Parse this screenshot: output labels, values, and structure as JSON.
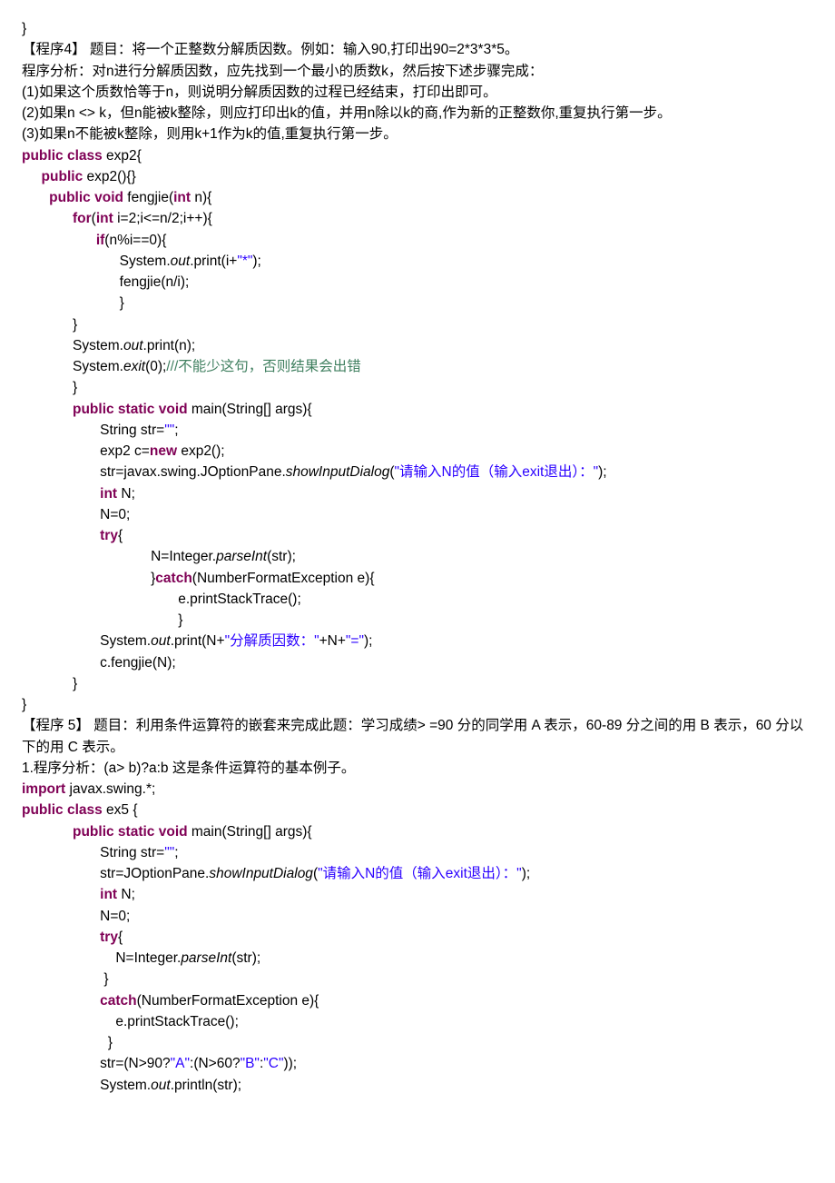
{
  "lines": [
    {
      "cls": "code",
      "segs": [
        {
          "t": "}"
        }
      ]
    },
    {
      "cls": "txt",
      "segs": [
        {
          "t": "【程序4】   题目：将一个正整数分解质因数。例如：输入90,打印出90=2*3*3*5。"
        }
      ]
    },
    {
      "cls": "txt",
      "segs": [
        {
          "t": "程序分析：对n进行分解质因数，应先找到一个最小的质数k，然后按下述步骤完成："
        }
      ]
    },
    {
      "cls": "txt",
      "segs": [
        {
          "t": "(1)如果这个质数恰等于n，则说明分解质因数的过程已经结束，打印出即可。"
        }
      ]
    },
    {
      "cls": "txt",
      "segs": [
        {
          "t": "(2)如果n <> k，但n能被k整除，则应打印出k的值，并用n除以k的商,作为新的正整数你,重复执行第一步。"
        }
      ]
    },
    {
      "cls": "txt",
      "segs": [
        {
          "t": "(3)如果n不能被k整除，则用k+1作为k的值,重复执行第一步。"
        }
      ]
    },
    {
      "cls": "code",
      "segs": [
        {
          "t": "public class",
          "c": "kw"
        },
        {
          "t": " exp2{"
        }
      ]
    },
    {
      "cls": "code",
      "segs": [
        {
          "t": "     "
        },
        {
          "t": "public",
          "c": "kw"
        },
        {
          "t": " exp2(){}"
        }
      ]
    },
    {
      "cls": "code",
      "segs": [
        {
          "t": "       "
        },
        {
          "t": "public void",
          "c": "kw"
        },
        {
          "t": " fengjie("
        },
        {
          "t": "int",
          "c": "kw"
        },
        {
          "t": " n){"
        }
      ]
    },
    {
      "cls": "code",
      "segs": [
        {
          "t": "             "
        },
        {
          "t": "for",
          "c": "kw"
        },
        {
          "t": "("
        },
        {
          "t": "int",
          "c": "kw"
        },
        {
          "t": " i=2;i<=n/2;i++){"
        }
      ]
    },
    {
      "cls": "code",
      "segs": [
        {
          "t": "                   "
        },
        {
          "t": "if",
          "c": "kw"
        },
        {
          "t": "(n%i==0){"
        }
      ]
    },
    {
      "cls": "code",
      "segs": [
        {
          "t": "                         System."
        },
        {
          "t": "out",
          "c": "it"
        },
        {
          "t": ".print(i+"
        },
        {
          "t": "\"*\"",
          "c": "str"
        },
        {
          "t": ");"
        }
      ]
    },
    {
      "cls": "code",
      "segs": [
        {
          "t": "                         fengjie(n/i);"
        }
      ]
    },
    {
      "cls": "code",
      "segs": [
        {
          "t": "                         }"
        }
      ]
    },
    {
      "cls": "code",
      "segs": [
        {
          "t": "             }"
        }
      ]
    },
    {
      "cls": "code",
      "segs": [
        {
          "t": "             System."
        },
        {
          "t": "out",
          "c": "it"
        },
        {
          "t": ".print(n);"
        }
      ]
    },
    {
      "cls": "code",
      "segs": [
        {
          "t": "             System."
        },
        {
          "t": "exit",
          "c": "it"
        },
        {
          "t": "(0);"
        },
        {
          "t": "///不能少这句，否则结果会出错",
          "c": "cmt"
        }
      ]
    },
    {
      "cls": "code",
      "segs": [
        {
          "t": "             }"
        }
      ]
    },
    {
      "cls": "code",
      "segs": [
        {
          "t": "             "
        },
        {
          "t": "public static void",
          "c": "kw"
        },
        {
          "t": " main(String[] args){"
        }
      ]
    },
    {
      "cls": "code",
      "segs": [
        {
          "t": "                    String str="
        },
        {
          "t": "\"\"",
          "c": "str"
        },
        {
          "t": ";"
        }
      ]
    },
    {
      "cls": "code",
      "segs": [
        {
          "t": "                    exp2 c="
        },
        {
          "t": "new",
          "c": "kw"
        },
        {
          "t": " exp2();"
        }
      ]
    },
    {
      "cls": "code",
      "segs": [
        {
          "t": "                    str=javax.swing.JOptionPane."
        },
        {
          "t": "showInputDialog",
          "c": "it"
        },
        {
          "t": "("
        },
        {
          "t": "\"请输入N的值（输入exit退出）：\"",
          "c": "str"
        },
        {
          "t": ");"
        }
      ]
    },
    {
      "cls": "code",
      "segs": [
        {
          "t": "                    "
        },
        {
          "t": "int",
          "c": "kw"
        },
        {
          "t": " N;"
        }
      ]
    },
    {
      "cls": "code",
      "segs": [
        {
          "t": "                    N=0;"
        }
      ]
    },
    {
      "cls": "code",
      "segs": [
        {
          "t": "                    "
        },
        {
          "t": "try",
          "c": "kw"
        },
        {
          "t": "{"
        }
      ]
    },
    {
      "cls": "code",
      "segs": [
        {
          "t": "                                 N=Integer."
        },
        {
          "t": "parseInt",
          "c": "it"
        },
        {
          "t": "(str);"
        }
      ]
    },
    {
      "cls": "code",
      "segs": [
        {
          "t": "                                 }"
        },
        {
          "t": "catch",
          "c": "kw"
        },
        {
          "t": "(NumberFormatException e){"
        }
      ]
    },
    {
      "cls": "code",
      "segs": [
        {
          "t": "                                        e.printStackTrace();"
        }
      ]
    },
    {
      "cls": "code",
      "segs": [
        {
          "t": "                                        }"
        }
      ]
    },
    {
      "cls": "code",
      "segs": [
        {
          "t": "                    System."
        },
        {
          "t": "out",
          "c": "it"
        },
        {
          "t": ".print(N+"
        },
        {
          "t": "\"分解质因数：\"",
          "c": "str"
        },
        {
          "t": "+N+"
        },
        {
          "t": "\"=\"",
          "c": "str"
        },
        {
          "t": ");"
        }
      ]
    },
    {
      "cls": "code",
      "segs": [
        {
          "t": "                    c.fengjie(N);"
        }
      ]
    },
    {
      "cls": "code",
      "segs": [
        {
          "t": "             }"
        }
      ]
    },
    {
      "cls": "code",
      "segs": [
        {
          "t": "}"
        }
      ]
    },
    {
      "cls": "txt",
      "segs": [
        {
          "t": "【程序 5】   题目：利用条件运算符的嵌套来完成此题：学习成绩> =90 分的同学用 A 表示，60-89 分之间的用 B 表示，60 分以下的用 C 表示。"
        }
      ]
    },
    {
      "cls": "txt",
      "segs": [
        {
          "t": "1.程序分析：(a> b)?a:b 这是条件运算符的基本例子。"
        }
      ]
    },
    {
      "cls": "code",
      "segs": [
        {
          "t": "import",
          "c": "kw"
        },
        {
          "t": " javax.swing.*;"
        }
      ]
    },
    {
      "cls": "code",
      "segs": [
        {
          "t": "public class",
          "c": "kw"
        },
        {
          "t": " ex5 {"
        }
      ]
    },
    {
      "cls": "code",
      "segs": [
        {
          "t": "             "
        },
        {
          "t": "public static void",
          "c": "kw"
        },
        {
          "t": " main(String[] args){"
        }
      ]
    },
    {
      "cls": "code",
      "segs": [
        {
          "t": "                    String str="
        },
        {
          "t": "\"\"",
          "c": "str"
        },
        {
          "t": ";"
        }
      ]
    },
    {
      "cls": "code",
      "segs": [
        {
          "t": "                    str=JOptionPane."
        },
        {
          "t": "showInputDialog",
          "c": "it"
        },
        {
          "t": "("
        },
        {
          "t": "\"请输入N的值（输入exit退出）：\"",
          "c": "str"
        },
        {
          "t": ");"
        }
      ]
    },
    {
      "cls": "code",
      "segs": [
        {
          "t": "                    "
        },
        {
          "t": "int",
          "c": "kw"
        },
        {
          "t": " N;"
        }
      ]
    },
    {
      "cls": "code",
      "segs": [
        {
          "t": "                    N=0;"
        }
      ]
    },
    {
      "cls": "code",
      "segs": [
        {
          "t": "                    "
        },
        {
          "t": "try",
          "c": "kw"
        },
        {
          "t": "{"
        }
      ]
    },
    {
      "cls": "code",
      "segs": [
        {
          "t": "                        N=Integer."
        },
        {
          "t": "parseInt",
          "c": "it"
        },
        {
          "t": "(str);"
        }
      ]
    },
    {
      "cls": "code",
      "segs": [
        {
          "t": "                     }"
        }
      ]
    },
    {
      "cls": "code",
      "segs": [
        {
          "t": "                    "
        },
        {
          "t": "catch",
          "c": "kw"
        },
        {
          "t": "(NumberFormatException e){"
        }
      ]
    },
    {
      "cls": "code",
      "segs": [
        {
          "t": "                        e.printStackTrace();"
        }
      ]
    },
    {
      "cls": "code",
      "segs": [
        {
          "t": "                      }"
        }
      ]
    },
    {
      "cls": "code",
      "segs": [
        {
          "t": "                    str=(N>90?"
        },
        {
          "t": "\"A\"",
          "c": "str"
        },
        {
          "t": ":(N>60?"
        },
        {
          "t": "\"B\"",
          "c": "str"
        },
        {
          "t": ":"
        },
        {
          "t": "\"C\"",
          "c": "str"
        },
        {
          "t": "));"
        }
      ]
    },
    {
      "cls": "code",
      "segs": [
        {
          "t": "                    System."
        },
        {
          "t": "out",
          "c": "it"
        },
        {
          "t": ".println(str);"
        }
      ]
    }
  ]
}
